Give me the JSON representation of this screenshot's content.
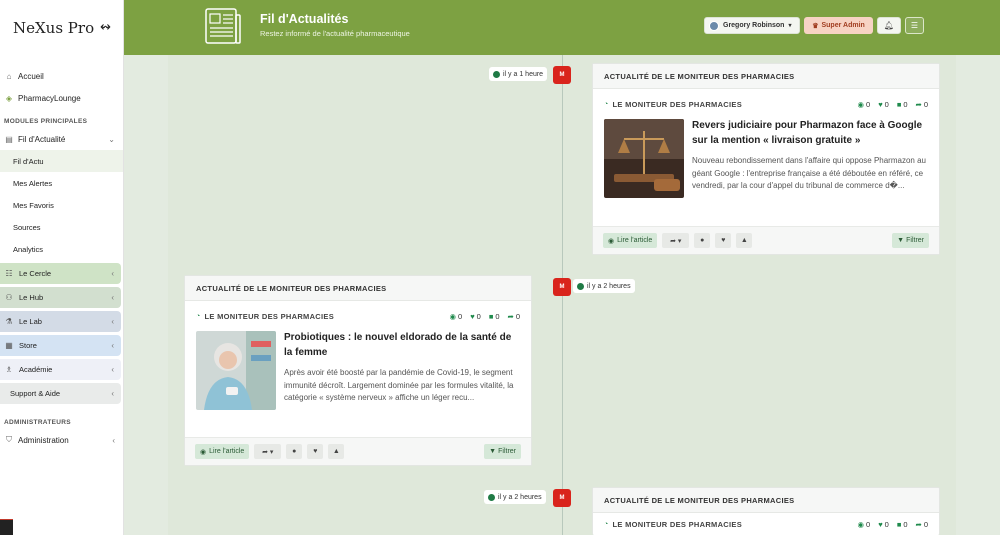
{
  "brand": {
    "name": "NeXus Pro",
    "mark": "↭"
  },
  "sidebar": {
    "top_items": [
      {
        "label": "Accueil",
        "icon": "home-icon"
      },
      {
        "label": "PharmacyLounge",
        "icon": "lounge-icon"
      }
    ],
    "section_modules": "MODULES PRINCIPALES",
    "fil": {
      "label": "Fil d'Actualité",
      "icon": "newspaper-icon"
    },
    "fil_subitems": [
      "Fil d'Actu",
      "Mes Alertes",
      "Mes Favoris",
      "Sources",
      "Analytics"
    ],
    "groups": [
      {
        "label": "Le Cercle",
        "color": "#cfe3c6"
      },
      {
        "label": "Le Hub",
        "color": "#d2dfcf"
      },
      {
        "label": "Le Lab",
        "color": "#d3dbe6"
      },
      {
        "label": "Store",
        "color": "#d4e3f3"
      },
      {
        "label": "Académie",
        "color": "#eef0f7"
      },
      {
        "label": "Support & Aide",
        "color": "#e9ebea"
      }
    ],
    "section_admin": "ADMINISTRATEURS",
    "admin": {
      "label": "Administration"
    }
  },
  "header": {
    "title": "Fil d'Actualités",
    "subtitle": "Restez informé de l'actualité pharmaceutique",
    "user_name": "Gregory Robinson",
    "role": "Super Admin",
    "color": "#7da142"
  },
  "feed": [
    {
      "time": "il y a 1 heure",
      "card_title": "ACTUALITÉ DE LE MONITEUR DES PHARMACIES",
      "source": "LE MONITEUR DES PHARMACIES",
      "views": "0",
      "likes": "0",
      "comments": "0",
      "shares": "0",
      "title": "Revers judiciaire pour Pharmazon face à Google sur la mention « livraison gratuite »",
      "excerpt": "Nouveau rebondissement dans l'affaire qui oppose Pharmazon au géant Google : l'entreprise française a été déboutée en référé, ce vendredi, par la cour d'appel du tribunal de commerce d�...",
      "read_label": "Lire l'article",
      "filter_label": "Filtrer"
    },
    {
      "time": "il y a 2 heures",
      "card_title": "ACTUALITÉ DE LE MONITEUR DES PHARMACIES",
      "source": "LE MONITEUR DES PHARMACIES",
      "views": "0",
      "likes": "0",
      "comments": "0",
      "shares": "0",
      "title": "Probiotiques : le nouvel eldorado de la santé de la femme",
      "excerpt": "Après avoir été boosté par la pandémie de Covid-19, le segment immunité décroît. Largement dominée par les formules vitalité, la catégorie « système nerveux » affiche un léger recu...",
      "read_label": "Lire l'article",
      "filter_label": "Filtrer"
    },
    {
      "time": "il y a 2 heures",
      "card_title": "ACTUALITÉ DE LE MONITEUR DES PHARMACIES",
      "source": "LE MONITEUR DES PHARMACIES",
      "views": "0",
      "likes": "0",
      "comments": "0",
      "shares": "0"
    }
  ],
  "source_logo": "M"
}
